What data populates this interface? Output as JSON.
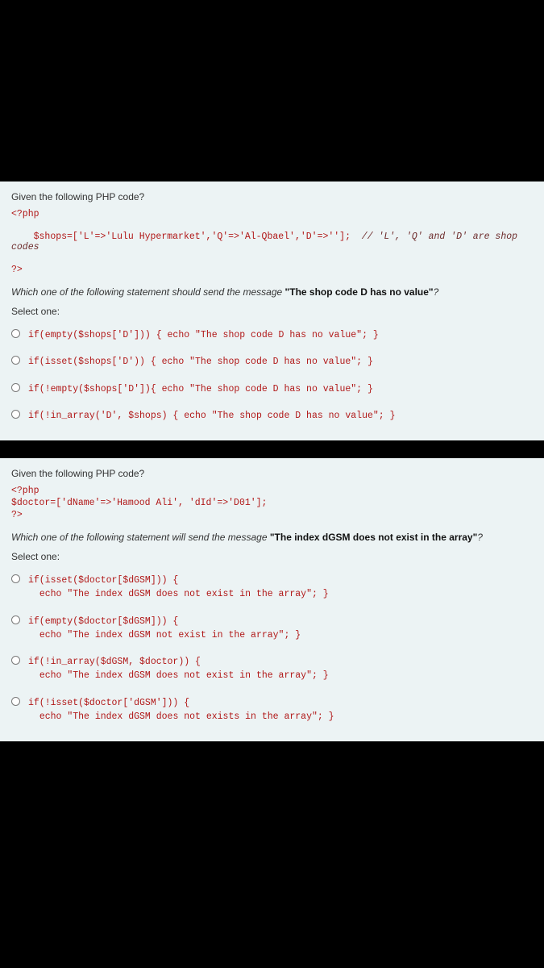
{
  "q1": {
    "intro": "Given the following PHP code?",
    "code": [
      "<?php",
      "$shops=['L'=>'Lulu Hypermarket','Q'=>'Al-Qbael','D'=>''];"
    ],
    "code_comment": "  // 'L', 'Q' and 'D' are shop codes",
    "close": "?>",
    "prompt_pre": "Which one of the following statement should send the message ",
    "prompt_bold": "\"The shop code D has no value\"",
    "prompt_post": "?",
    "select_label": "Select one:",
    "options": [
      "if(empty($shops['D'])) { echo \"The shop code D has no value\"; }",
      "if(isset($shops['D')) { echo \"The shop code D has no value\"; }",
      "if(!empty($shops['D']){ echo \"The shop code D has no value\"; }",
      "if(!in_array('D', $shops) { echo \"The shop code D has no value\"; }"
    ]
  },
  "q2": {
    "intro": "Given the following PHP code?",
    "code": [
      "<?php",
      "$doctor=['dName'=>'Hamood Ali', 'dId'=>'D01'];",
      "?>"
    ],
    "prompt_pre": "Which one of the following statement will send the message ",
    "prompt_bold": "\"The index dGSM does not exist in the array\"",
    "prompt_post": "?",
    "select_label": "Select one:",
    "options": [
      {
        "l1": "if(isset($doctor[$dGSM])) {",
        "l2": "  echo \"The index dGSM does not exist in the array\"; }"
      },
      {
        "l1": "if(empty($doctor[$dGSM])) {",
        "l2": "  echo \"The index dGSM not exist in the array\"; }"
      },
      {
        "l1": "if(!in_array($dGSM, $doctor)) {",
        "l2": "  echo \"The index dGSM does not exist in the array\"; }"
      },
      {
        "l1": "if(!isset($doctor['dGSM'])) {",
        "l2": "  echo \"The index dGSM does not exists in the array\"; }"
      }
    ]
  }
}
